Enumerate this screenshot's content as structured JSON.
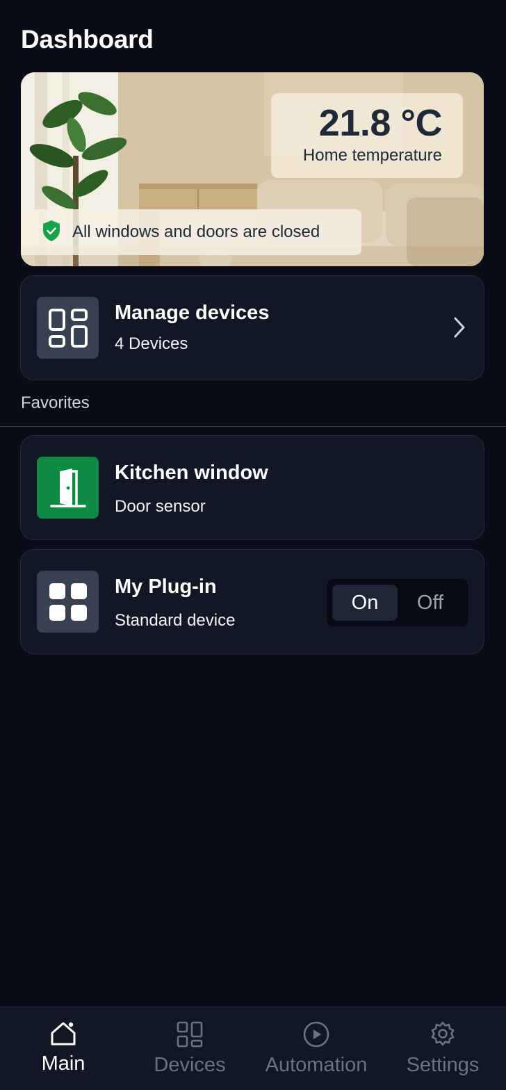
{
  "page": {
    "title": "Dashboard"
  },
  "hero": {
    "temperature": "21.8 °C",
    "temperature_label": "Home temperature",
    "status": "All windows and doors are closed"
  },
  "manage": {
    "title": "Manage devices",
    "subtitle": "4 Devices"
  },
  "favorites": {
    "label": "Favorites",
    "items": [
      {
        "title": "Kitchen window",
        "subtitle": "Door sensor",
        "icon": "door-icon",
        "color": "#0f8a44"
      },
      {
        "title": "My Plug-in",
        "subtitle": "Standard device",
        "icon": "grid-icon",
        "toggle": {
          "on_label": "On",
          "off_label": "Off",
          "selected": "On"
        }
      }
    ]
  },
  "nav": {
    "items": [
      {
        "label": "Main",
        "icon": "home-icon",
        "active": true
      },
      {
        "label": "Devices",
        "icon": "devices-icon",
        "active": false
      },
      {
        "label": "Automation",
        "icon": "play-icon",
        "active": false
      },
      {
        "label": "Settings",
        "icon": "gear-icon",
        "active": false
      }
    ]
  },
  "colors": {
    "background": "#0a0d17",
    "card": "#121726",
    "accent_green": "#0f8a44",
    "shield_green": "#16a34a"
  }
}
